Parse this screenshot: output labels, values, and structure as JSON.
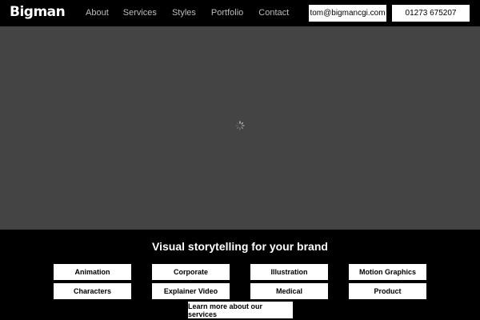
{
  "header": {
    "logo": "Bigman",
    "nav": [
      "About",
      "Services",
      "Styles",
      "Portfolio",
      "Contact"
    ],
    "email": "tom@bigmancgi.com",
    "phone": "01273 675207"
  },
  "hero": {
    "icon": "loading-spinner-icon",
    "background": "#444444"
  },
  "services_section": {
    "tagline": "Visual storytelling for your brand",
    "row1": [
      "Animation",
      "Corporate",
      "Illustration",
      "Motion Graphics"
    ],
    "row2": [
      "Characters",
      "Explainer Video",
      "Medical",
      "Product"
    ],
    "cta": "Learn more about our services"
  }
}
